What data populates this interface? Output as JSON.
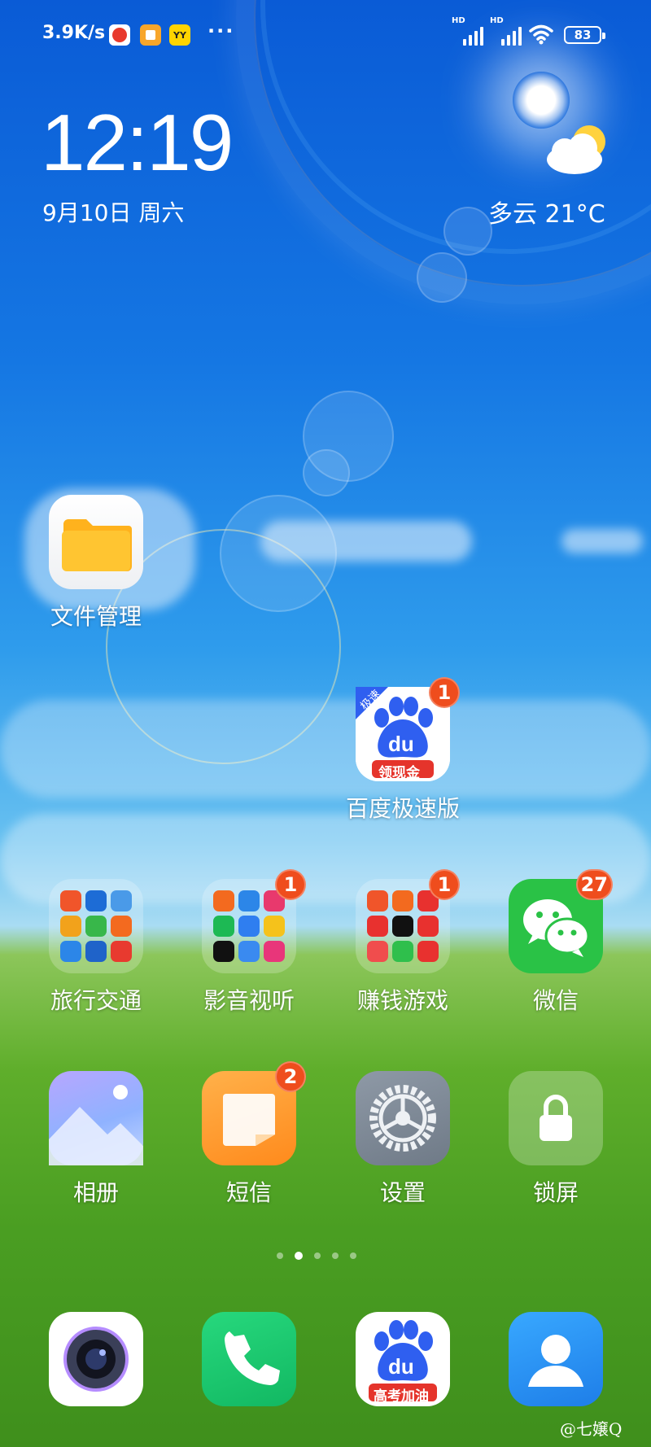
{
  "status_bar": {
    "network_speed": "3.9K/s",
    "hd1": "HD",
    "hd2": "HD",
    "battery": "83",
    "more": "···"
  },
  "clock": {
    "time": "12:19",
    "date": "9月10日 周六"
  },
  "weather": {
    "text": "多云 21°C"
  },
  "apps": {
    "file_manager": {
      "label": "文件管理"
    },
    "baidu_lite": {
      "label": "百度极速版",
      "badge": "1",
      "top_tag": "极速",
      "bottom_tag": "领现金",
      "logo": "du"
    },
    "travel": {
      "label": "旅行交通"
    },
    "media": {
      "label": "影音视听",
      "badge": "1"
    },
    "games": {
      "label": "赚钱游戏",
      "badge": "1"
    },
    "wechat": {
      "label": "微信",
      "badge": "27"
    },
    "gallery": {
      "label": "相册"
    },
    "messages": {
      "label": "短信",
      "badge": "2"
    },
    "settings": {
      "label": "设置"
    },
    "lock": {
      "label": "锁屏"
    }
  },
  "dock": {
    "baidu_tag": "高考加油",
    "baidu_logo": "du"
  },
  "watermark": "@七嬢Q",
  "colors": {
    "badge": "#ef4d1d",
    "wechat": "#2ac246",
    "phone": "#19c66e",
    "contacts": "#1e8ef0"
  }
}
